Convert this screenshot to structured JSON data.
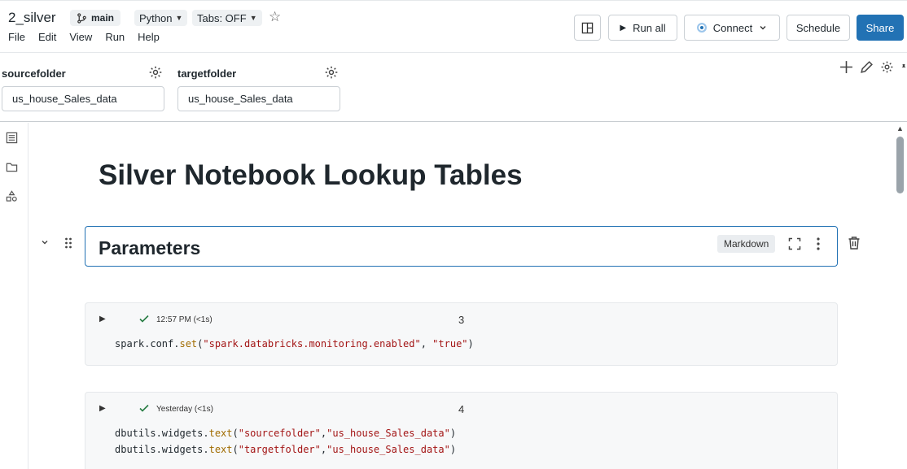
{
  "header": {
    "title": "2_silver",
    "branch": "main",
    "language": "Python",
    "tabs": "Tabs: OFF",
    "menu": [
      "File",
      "Edit",
      "View",
      "Run",
      "Help"
    ],
    "run_all": "Run all",
    "connect": "Connect",
    "schedule": "Schedule",
    "share": "Share"
  },
  "widgets": [
    {
      "label": "sourcefolder",
      "value": "us_house_Sales_data"
    },
    {
      "label": "targetfolder",
      "value": "us_house_Sales_data"
    }
  ],
  "notebook": {
    "title": "Silver Notebook Lookup Tables",
    "markdown_cell": {
      "title": "Parameters",
      "badge": "Markdown"
    },
    "cells": [
      {
        "status": "12:57 PM (<1s)",
        "number": "3",
        "lines": [
          [
            {
              "t": "spark.conf."
            },
            {
              "t": "set",
              "c": "fn"
            },
            {
              "t": "("
            },
            {
              "t": "\"spark.databricks.monitoring.enabled\"",
              "c": "str"
            },
            {
              "t": ", "
            },
            {
              "t": "\"true\"",
              "c": "str"
            },
            {
              "t": ")"
            }
          ]
        ]
      },
      {
        "status": "Yesterday (<1s)",
        "number": "4",
        "lines": [
          [
            {
              "t": "dbutils.widgets."
            },
            {
              "t": "text",
              "c": "fn"
            },
            {
              "t": "("
            },
            {
              "t": "\"sourcefolder\"",
              "c": "str"
            },
            {
              "t": ","
            },
            {
              "t": "\"us_house_Sales_data\"",
              "c": "str"
            },
            {
              "t": ")"
            }
          ],
          [
            {
              "t": "dbutils.widgets."
            },
            {
              "t": "text",
              "c": "fn"
            },
            {
              "t": "("
            },
            {
              "t": "\"targetfolder\"",
              "c": "str"
            },
            {
              "t": ","
            },
            {
              "t": "\"us_house_Sales_data\"",
              "c": "str"
            },
            {
              "t": ")"
            }
          ]
        ]
      }
    ]
  },
  "colors": {
    "accent": "#2272b4",
    "success": "#277c43",
    "string": "#a31515",
    "function": "#a06b00"
  }
}
